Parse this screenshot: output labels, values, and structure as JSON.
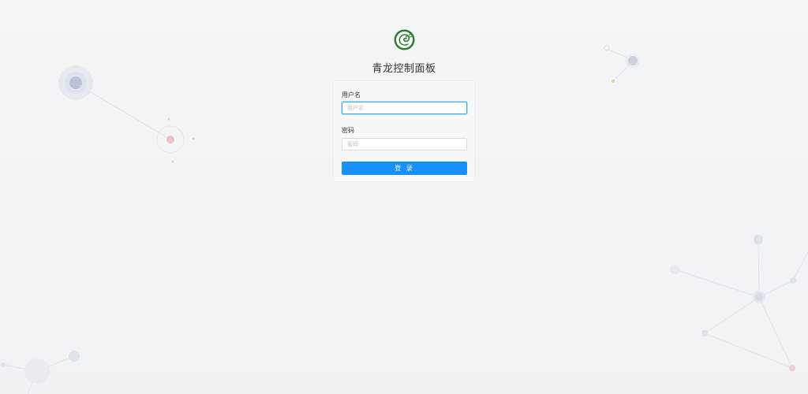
{
  "app": {
    "title": "青龙控制面板",
    "logo_icon": "qinglong-dragon-logo-icon"
  },
  "login_form": {
    "username_label": "用户名",
    "username_placeholder": "用户名",
    "username_value": "",
    "password_label": "密码",
    "password_placeholder": "密码",
    "password_value": "",
    "submit_label": "登 录"
  },
  "colors": {
    "primary": "#1890ff",
    "background": "#f0f2f5",
    "logo_green": "#2e7d32"
  }
}
